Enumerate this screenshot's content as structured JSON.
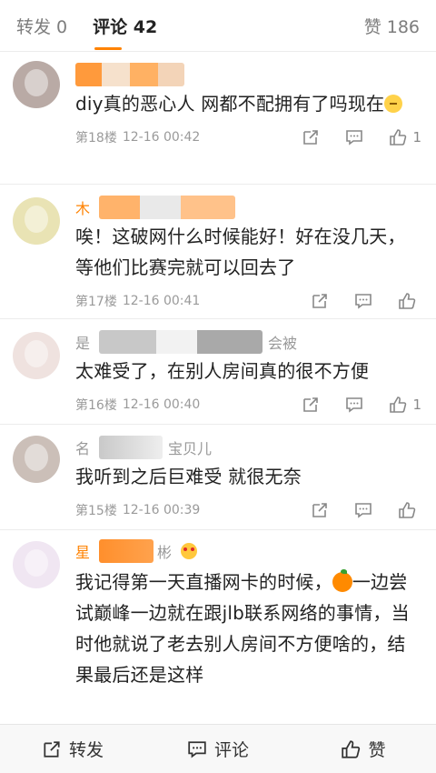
{
  "tabs": {
    "repost": "转发 0",
    "comments": "评论 42",
    "likes": "赞 186"
  },
  "comments": [
    {
      "author": "",
      "text_before_emoji": "diy真的恶心人 网都不配拥有了吗现在",
      "floor": "第18楼",
      "time": "12-16 00:42",
      "like_count": "1"
    },
    {
      "author": "木",
      "text": "唉！这破网什么时候能好！好在没几天，等他们比赛完就可以回去了",
      "floor": "第17楼",
      "time": "12-16 00:41",
      "like_count": ""
    },
    {
      "author": "是",
      "author_tail": "会被",
      "text": "太难受了，在别人房间真的很不方便",
      "floor": "第16楼",
      "time": "12-16 00:40",
      "like_count": "1"
    },
    {
      "author": "名",
      "author_tail": "宝贝儿",
      "text": "我听到之后巨难受 就很无奈",
      "floor": "第15楼",
      "time": "12-16 00:39",
      "like_count": ""
    },
    {
      "author": "星",
      "author_tail": "彬",
      "text_part1": "我记得第一天直播网卡的时候，",
      "text_part2": "一边尝试巅峰一边就在跟jlb联系网络的事情，当时他就说了老去别人房间不方便啥的，结果最后还是这样"
    }
  ],
  "bottom_bar": {
    "repost": "转发",
    "comment": "评论",
    "like": "赞"
  },
  "icons": {
    "share": "share-icon",
    "comment": "comment-icon",
    "like": "thumbs-up-icon"
  },
  "colors": {
    "accent": "#ff8200",
    "meta_text": "#9a9a9a",
    "body_text": "#222222"
  }
}
